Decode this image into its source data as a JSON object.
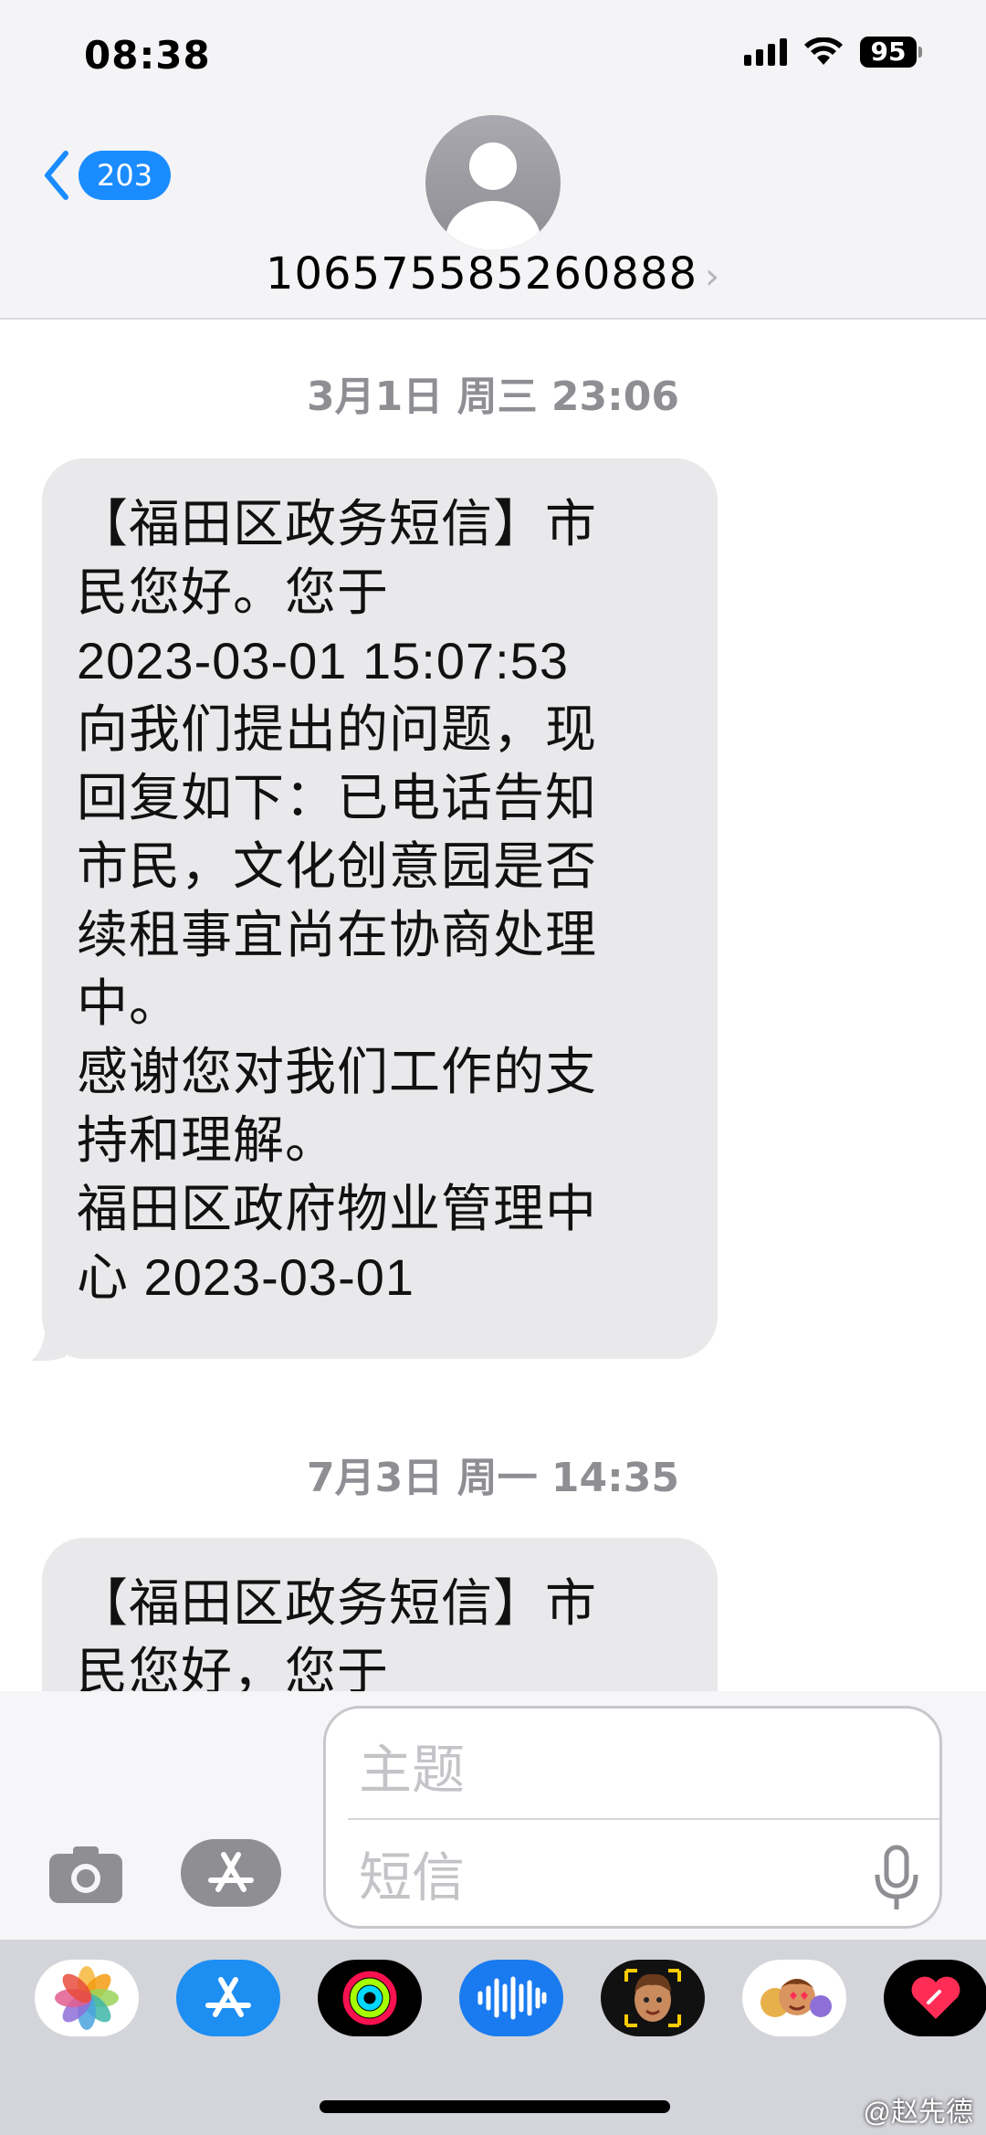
{
  "status_bar": {
    "time": "08:38",
    "battery": "95"
  },
  "header": {
    "back_count": "203",
    "contact_number": "106575585260888",
    "chevron": "›"
  },
  "messages": [
    {
      "timestamp": "3月1日 周三 23:06",
      "lines": [
        "【福田区政务短信】市",
        "民您好。您于",
        "2023-03-01 15:07:53",
        "向我们提出的问题，现",
        "回复如下：已电话告知",
        "市民，文化创意园是否",
        "续租事宜尚在协商处理",
        "中。",
        "感谢您对我们工作的支",
        "持和理解。",
        "福田区政府物业管理中",
        "心 2023-03-01"
      ]
    },
    {
      "timestamp": "7月3日 周一 14:35",
      "lines": [
        "【福田区政务短信】市",
        "民您好，您于"
      ]
    }
  ],
  "composer": {
    "subject_placeholder": "主题",
    "body_placeholder": "短信"
  },
  "app_drawer": [
    "photos-icon",
    "app-store-icon",
    "fitness-icon",
    "audio-message-icon",
    "memoji-icon",
    "memoji-stickers-icon",
    "digital-touch-icon"
  ],
  "watermark": "@赵先德",
  "colors": {
    "accent": "#1a8cff",
    "bubble": "#e9e9eb",
    "timestamp": "#8e8e93"
  }
}
